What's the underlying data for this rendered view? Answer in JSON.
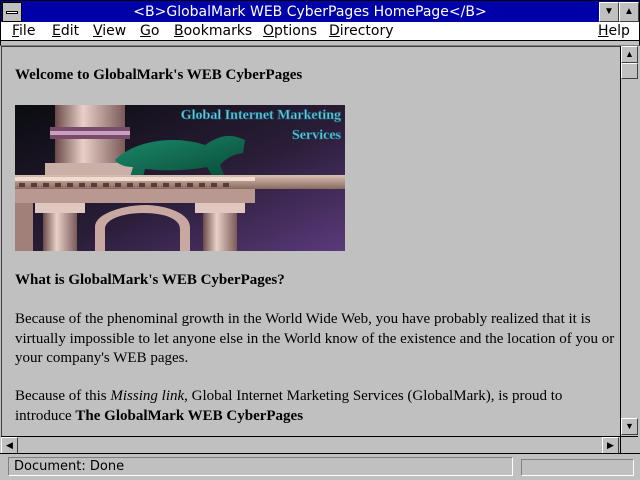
{
  "window": {
    "title": "<B>GlobalMark WEB CyberPages HomePage</B>"
  },
  "menu": {
    "file": {
      "u": "F",
      "rest": "ile"
    },
    "edit": {
      "u": "E",
      "rest": "dit"
    },
    "view": {
      "u": "V",
      "rest": "iew"
    },
    "go": {
      "u": "G",
      "rest": "o"
    },
    "bookmarks": {
      "u": "B",
      "rest": "ookmarks"
    },
    "options": {
      "u": "O",
      "rest": "ptions"
    },
    "directory": {
      "u": "D",
      "rest": "irectory"
    },
    "help": {
      "u": "H",
      "rest": "elp"
    }
  },
  "page": {
    "welcome_heading": "Welcome to GlobalMark's WEB CyberPages",
    "banner_text_line1": "Global Internet Marketing",
    "banner_text_line2": "Services",
    "what_heading": "What is GlobalMark's WEB CyberPages?",
    "para1": "Because of the phenominal growth in the World Wide Web, you have probably realized that it is virtually impossible to let anyone else in the World know of the existence and the location of you or your company's WEB pages.",
    "para2_start": "Because of this ",
    "para2_italic": "Missing link",
    "para2_mid": ", Global Internet Marketing Services (GlobalMark), is proud to introduce ",
    "para2_bold": "The GlobalMark WEB CyberPages"
  },
  "status": {
    "text": "Document: Done"
  },
  "colors": {
    "titlebar": "#0000a8",
    "chrome": "#c0c0c0",
    "banner_text": "#5ad0e0"
  },
  "icons": {
    "system_menu": "system-menu-icon",
    "minimize": "minimize-arrow-icon",
    "maximize": "maximize-arrow-icon"
  }
}
